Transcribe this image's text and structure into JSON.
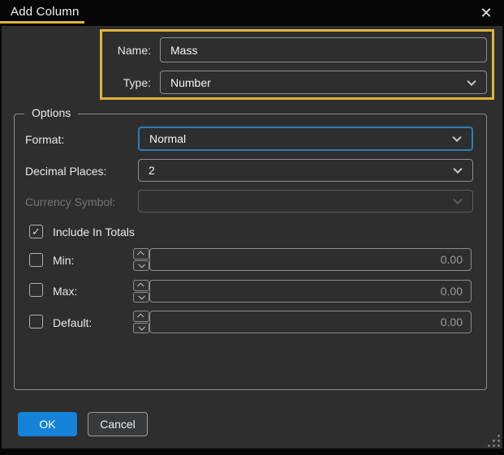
{
  "window": {
    "title": "Add Column"
  },
  "icons": {
    "close": "✕",
    "check": "✓"
  },
  "fields": {
    "name": {
      "label": "Name:",
      "value": "Mass"
    },
    "type": {
      "label": "Type:",
      "value": "Number"
    }
  },
  "options": {
    "legend": "Options",
    "format": {
      "label": "Format:",
      "value": "Normal"
    },
    "decimal_places": {
      "label": "Decimal Places:",
      "value": "2"
    },
    "currency_symbol": {
      "label": "Currency Symbol:",
      "value": ""
    },
    "include_in_totals": {
      "label": "Include In Totals",
      "checked": true
    },
    "min": {
      "label": "Min:",
      "value": "0.00",
      "checked": false
    },
    "max": {
      "label": "Max:",
      "value": "0.00",
      "checked": false
    },
    "default": {
      "label": "Default:",
      "value": "0.00",
      "checked": false
    }
  },
  "buttons": {
    "ok": "OK",
    "cancel": "Cancel"
  },
  "colors": {
    "accent_gold": "#e2b33c",
    "focus_blue": "#2e7cb4",
    "ok_blue": "#1584d8"
  }
}
